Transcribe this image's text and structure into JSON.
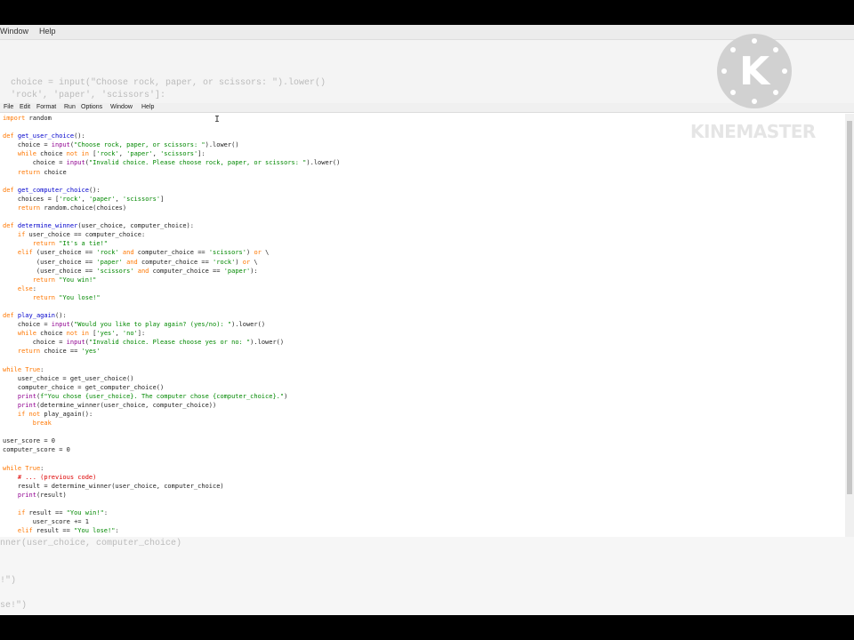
{
  "background_window": {
    "menu": [
      "Window",
      "Help"
    ],
    "ghost_lines": [
      "  choice = input(\"Choose rock, paper, or scissors: \").lower()",
      "  'rock', 'paper', 'scissors']:"
    ]
  },
  "editor": {
    "menu": [
      "File",
      "Edit",
      "Format",
      "Run",
      "Options",
      "Window",
      "Help"
    ],
    "code_lines": [
      "import random",
      "",
      "def get_user_choice():",
      "    choice = input(\"Choose rock, paper, or scissors: \").lower()",
      "    while choice not in ['rock', 'paper', 'scissors']:",
      "        choice = input(\"Invalid choice. Please choose rock, paper, or scissors: \").lower()",
      "    return choice",
      "",
      "def get_computer_choice():",
      "    choices = ['rock', 'paper', 'scissors']",
      "    return random.choice(choices)",
      "",
      "def determine_winner(user_choice, computer_choice):",
      "    if user_choice == computer_choice:",
      "        return \"It's a tie!\"",
      "    elif (user_choice == 'rock' and computer_choice == 'scissors') or \\",
      "         (user_choice == 'paper' and computer_choice == 'rock') or \\",
      "         (user_choice == 'scissors' and computer_choice == 'paper'):",
      "        return \"You win!\"",
      "    else:",
      "        return \"You lose!\"",
      "",
      "def play_again():",
      "    choice = input(\"Would you like to play again? (yes/no): \").lower()",
      "    while choice not in ['yes', 'no']:",
      "        choice = input(\"Invalid choice. Please choose yes or no: \").lower()",
      "    return choice == 'yes'",
      "",
      "while True:",
      "    user_choice = get_user_choice()",
      "    computer_choice = get_computer_choice()",
      "    print(f\"You chose {user_choice}. The computer chose {computer_choice}.\")",
      "    print(determine_winner(user_choice, computer_choice))",
      "    if not play_again():",
      "        break",
      "",
      "user_score = 0",
      "computer_score = 0",
      "",
      "while True:",
      "    # ... (previous code)",
      "    result = determine_winner(user_choice, computer_choice)",
      "    print(result)",
      "",
      "    if result == \"You win!\":",
      "        user_score += 1",
      "    elif result == \"You lose!\":"
    ]
  },
  "bottom_ghost_lines": [
    "nner(user_choice, computer_choice)",
    "",
    "",
    "!\")",
    "",
    "se!\")"
  ],
  "watermark": {
    "logo_letter": "K",
    "brand": "KINEMASTER"
  },
  "colors": {
    "keyword": "#ff7700",
    "function_def": "#0000cc",
    "builtin": "#900090",
    "string": "#008800",
    "comment": "#dd0000"
  }
}
